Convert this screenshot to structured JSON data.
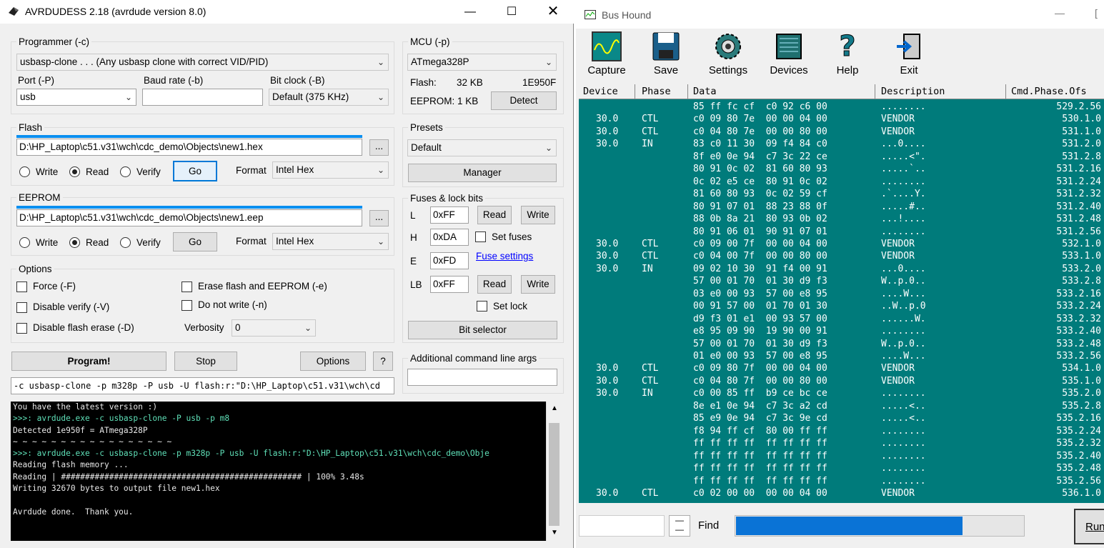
{
  "avr": {
    "title": "AVRDUDESS 2.18 (avrdude version 8.0)",
    "programmer": {
      "group_label": "Programmer (-c)",
      "value": "usbasp-clone . . . (Any usbasp clone with correct VID/PID)",
      "port_label": "Port (-P)",
      "port_value": "usb",
      "baud_label": "Baud rate (-b)",
      "baud_value": "",
      "bitclock_label": "Bit clock (-B)",
      "bitclock_value": "Default (375 KHz)"
    },
    "mcu": {
      "group_label": "MCU (-p)",
      "value": "ATmega328P",
      "flash_label": "Flash:",
      "flash_size": "32 KB",
      "signature": "1E950F",
      "eeprom_text": "EEPROM: 1 KB",
      "detect_label": "Detect"
    },
    "flash": {
      "group_label": "Flash",
      "path": "D:\\HP_Laptop\\c51.v31\\wch\\cdc_demo\\Objects\\new1.hex",
      "browse": "...",
      "write": "Write",
      "read": "Read",
      "verify": "Verify",
      "go": "Go",
      "format_label": "Format",
      "format_value": "Intel Hex"
    },
    "eeprom": {
      "group_label": "EEPROM",
      "path": "D:\\HP_Laptop\\c51.v31\\wch\\cdc_demo\\Objects\\new1.eep",
      "browse": "...",
      "write": "Write",
      "read": "Read",
      "verify": "Verify",
      "go": "Go",
      "format_label": "Format",
      "format_value": "Intel Hex"
    },
    "presets": {
      "group_label": "Presets",
      "value": "Default",
      "manager": "Manager"
    },
    "fuses": {
      "group_label": "Fuses & lock bits",
      "l_label": "L",
      "l_value": "0xFF",
      "h_label": "H",
      "h_value": "0xDA",
      "e_label": "E",
      "e_value": "0xFD",
      "lb_label": "LB",
      "lb_value": "0xFF",
      "read": "Read",
      "write": "Write",
      "set_fuses": "Set fuses",
      "fuse_settings": "Fuse settings",
      "set_lock": "Set lock",
      "bit_selector": "Bit selector"
    },
    "options": {
      "group_label": "Options",
      "force": "Force (-F)",
      "disable_verify": "Disable verify (-V)",
      "disable_flash_erase": "Disable flash erase (-D)",
      "erase": "Erase flash and EEPROM (-e)",
      "no_write": "Do not write (-n)",
      "verbosity_label": "Verbosity",
      "verbosity_value": "0"
    },
    "actions": {
      "program": "Program!",
      "stop": "Stop",
      "options": "Options",
      "help": "?"
    },
    "additional_label": "Additional command line args",
    "additional_value": "",
    "cmdline": "-c usbasp-clone -p m328p -P usb -U flash:r:\"D:\\HP_Laptop\\c51.v31\\wch\\cd",
    "console": [
      {
        "text": "You have the latest version :)",
        "kind": "normal"
      },
      {
        "text": ">>>: avrdude.exe -c usbasp-clone -P usb -p m8",
        "kind": "cmd"
      },
      {
        "text": "Detected 1e950f = ATmega328P",
        "kind": "normal"
      },
      {
        "text": "~ ~ ~ ~ ~ ~ ~ ~ ~ ~ ~ ~ ~ ~ ~ ~ ~",
        "kind": "normal"
      },
      {
        "text": ">>>: avrdude.exe -c usbasp-clone -p m328p -P usb -U flash:r:\"D:\\HP_Laptop\\c51.v31\\wch\\cdc_demo\\Obje",
        "kind": "cmd"
      },
      {
        "text": "Reading flash memory ...",
        "kind": "normal"
      },
      {
        "text": "Reading | ################################################## | 100% 3.48s",
        "kind": "normal"
      },
      {
        "text": "Writing 32670 bytes to output file new1.hex",
        "kind": "normal"
      },
      {
        "text": "",
        "kind": "normal"
      },
      {
        "text": "Avrdude done.  Thank you.",
        "kind": "normal"
      }
    ]
  },
  "bushound": {
    "title": "Bus Hound",
    "toolbar": [
      "Capture",
      "Save",
      "Settings",
      "Devices",
      "Help",
      "Exit"
    ],
    "columns": [
      "Device",
      "Phase",
      "Data",
      "Description",
      "Cmd.Phase.Ofs"
    ],
    "rows": [
      {
        "device": "",
        "phase": "",
        "data": "85 ff fc cf  c0 92 c6 00",
        "desc": "........",
        "ofs": "529.2.56"
      },
      {
        "device": "30.0",
        "phase": "CTL",
        "data": "c0 09 80 7e  00 00 04 00",
        "desc": "VENDOR",
        "ofs": "530.1.0"
      },
      {
        "device": "30.0",
        "phase": "CTL",
        "data": "c0 04 80 7e  00 00 80 00",
        "desc": "VENDOR",
        "ofs": "531.1.0"
      },
      {
        "device": "30.0",
        "phase": "IN",
        "data": "83 c0 11 30  09 f4 84 c0",
        "desc": "...0....",
        "ofs": "531.2.0"
      },
      {
        "device": "",
        "phase": "",
        "data": "8f e0 0e 94  c7 3c 22 ce",
        "desc": ".....<\".",
        "ofs": "531.2.8"
      },
      {
        "device": "",
        "phase": "",
        "data": "80 91 0c 02  81 60 80 93",
        "desc": ".....`..",
        "ofs": "531.2.16"
      },
      {
        "device": "",
        "phase": "",
        "data": "0c 02 e5 ce  80 91 0c 02",
        "desc": "........",
        "ofs": "531.2.24"
      },
      {
        "device": "",
        "phase": "",
        "data": "81 60 80 93  0c 02 59 cf",
        "desc": ".`....Y.",
        "ofs": "531.2.32"
      },
      {
        "device": "",
        "phase": "",
        "data": "80 91 07 01  88 23 88 0f",
        "desc": ".....#..",
        "ofs": "531.2.40"
      },
      {
        "device": "",
        "phase": "",
        "data": "88 0b 8a 21  80 93 0b 02",
        "desc": "...!....",
        "ofs": "531.2.48"
      },
      {
        "device": "",
        "phase": "",
        "data": "80 91 06 01  90 91 07 01",
        "desc": "........",
        "ofs": "531.2.56"
      },
      {
        "device": "30.0",
        "phase": "CTL",
        "data": "c0 09 00 7f  00 00 04 00",
        "desc": "VENDOR",
        "ofs": "532.1.0"
      },
      {
        "device": "30.0",
        "phase": "CTL",
        "data": "c0 04 00 7f  00 00 80 00",
        "desc": "VENDOR",
        "ofs": "533.1.0"
      },
      {
        "device": "30.0",
        "phase": "IN",
        "data": "09 02 10 30  91 f4 00 91",
        "desc": "...0....",
        "ofs": "533.2.0"
      },
      {
        "device": "",
        "phase": "",
        "data": "57 00 01 70  01 30 d9 f3",
        "desc": "W..p.0..",
        "ofs": "533.2.8"
      },
      {
        "device": "",
        "phase": "",
        "data": "03 e0 00 93  57 00 e8 95",
        "desc": "....W...",
        "ofs": "533.2.16"
      },
      {
        "device": "",
        "phase": "",
        "data": "00 91 57 00  01 70 01 30",
        "desc": "..W..p.0",
        "ofs": "533.2.24"
      },
      {
        "device": "",
        "phase": "",
        "data": "d9 f3 01 e1  00 93 57 00",
        "desc": "......W.",
        "ofs": "533.2.32"
      },
      {
        "device": "",
        "phase": "",
        "data": "e8 95 09 90  19 90 00 91",
        "desc": "........",
        "ofs": "533.2.40"
      },
      {
        "device": "",
        "phase": "",
        "data": "57 00 01 70  01 30 d9 f3",
        "desc": "W..p.0..",
        "ofs": "533.2.48"
      },
      {
        "device": "",
        "phase": "",
        "data": "01 e0 00 93  57 00 e8 95",
        "desc": "....W...",
        "ofs": "533.2.56"
      },
      {
        "device": "30.0",
        "phase": "CTL",
        "data": "c0 09 80 7f  00 00 04 00",
        "desc": "VENDOR",
        "ofs": "534.1.0"
      },
      {
        "device": "30.0",
        "phase": "CTL",
        "data": "c0 04 80 7f  00 00 80 00",
        "desc": "VENDOR",
        "ofs": "535.1.0"
      },
      {
        "device": "30.0",
        "phase": "IN",
        "data": "c0 00 85 ff  b9 ce bc ce",
        "desc": "........",
        "ofs": "535.2.0"
      },
      {
        "device": "",
        "phase": "",
        "data": "8e e1 0e 94  c7 3c a2 cd",
        "desc": ".....<..",
        "ofs": "535.2.8"
      },
      {
        "device": "",
        "phase": "",
        "data": "85 e9 0e 94  c7 3c 9e cd",
        "desc": ".....<..",
        "ofs": "535.2.16"
      },
      {
        "device": "",
        "phase": "",
        "data": "f8 94 ff cf  80 00 ff ff",
        "desc": "........",
        "ofs": "535.2.24"
      },
      {
        "device": "",
        "phase": "",
        "data": "ff ff ff ff  ff ff ff ff",
        "desc": "........",
        "ofs": "535.2.32"
      },
      {
        "device": "",
        "phase": "",
        "data": "ff ff ff ff  ff ff ff ff",
        "desc": "........",
        "ofs": "535.2.40"
      },
      {
        "device": "",
        "phase": "",
        "data": "ff ff ff ff  ff ff ff ff",
        "desc": "........",
        "ofs": "535.2.48"
      },
      {
        "device": "",
        "phase": "",
        "data": "ff ff ff ff  ff ff ff ff",
        "desc": "........",
        "ofs": "535.2.56"
      },
      {
        "device": "30.0",
        "phase": "CTL",
        "data": "c0 02 00 00  00 00 04 00",
        "desc": "VENDOR",
        "ofs": "536.1.0"
      }
    ],
    "find_label": "Find",
    "run_label": "Run",
    "colors": {
      "table_bg": "#007b7b",
      "progress": "#0a73d6"
    }
  }
}
